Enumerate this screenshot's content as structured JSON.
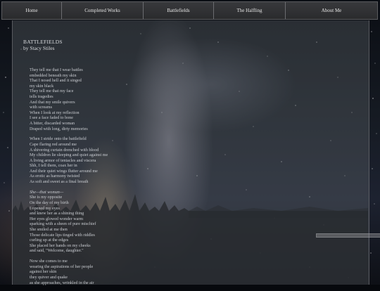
{
  "nav": {
    "items": [
      {
        "label": "Home"
      },
      {
        "label": "Completed Works"
      },
      {
        "label": "Battlefields"
      },
      {
        "label": "The Halfling"
      },
      {
        "label": "About Me"
      }
    ]
  },
  "page": {
    "title": "BATTLEFIELDS",
    "byline": "by Stacy Stiles"
  },
  "poem": {
    "stanza1": [
      "They tell me that I wear battles",
      "embedded beneath my skin",
      "That I nosed hell and it singed",
      "my skin black",
      "They tell me that my face",
      "tells tragedies",
      "And that my smile quivers",
      "with screams",
      "When I look at my reflection",
      "I see a face faded to bone",
      "A bitter, discarded woman",
      "Draped with long, dirty memories"
    ],
    "stanza2": [
      "When I stride onto the battlefield",
      "Cape flaring red around me",
      "A shivering curtain drenched with blood",
      "My children lie sleeping and quiet against me",
      "A living armor of tentacles and viscera",
      "Shh, I tell them, coax her in",
      "And their quiet wings flutter around me",
      "As erotic as harmony twisted",
      "As soft and sweet as a final breath"
    ],
    "stanza3_first": "She—that woman—",
    "stanza3": [
      "She is my opposite",
      "On the day of my birth",
      "I opened my eyes",
      "and knew her as a shining thing",
      "Her eyes glowed wonder warm",
      "sparking with a sheen of pure mischief",
      "She smiled at me then",
      "Those delicate lips tinged with riddles",
      "curling up at the edges",
      "She placed her hands on my cheeks",
      "and said, \"Welcome, daughter.\""
    ],
    "stanza4": [
      "Now she comes to me",
      "wearing the aspirations of her people",
      "against her skin",
      "they quiver and quake",
      "as she approaches, wrinkled in the air"
    ]
  }
}
